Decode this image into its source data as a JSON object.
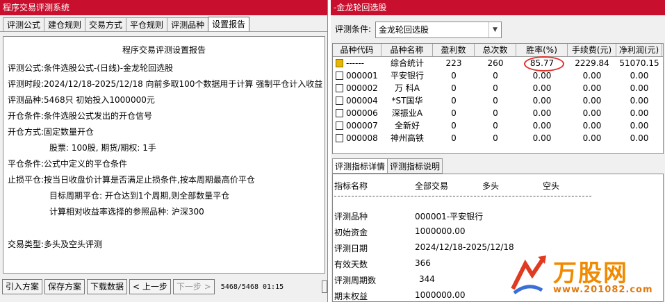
{
  "left": {
    "title": "程序交易评测系统",
    "tabs": [
      "评测公式",
      "建仓规则",
      "交易方式",
      "平仓规则",
      "评测品种",
      "设置报告"
    ],
    "report_title": "程序交易评测设置报告",
    "lines": [
      {
        "label": "评测公式:",
        "value": "条件选股公式-(日线)-金龙轮回选股"
      },
      {
        "label": "评测时段:",
        "value": "2024/12/18-2025/12/18 向前多取100个数据用于计算 强制平仓计入收益"
      },
      {
        "label": "评测品种:",
        "value": "5468只 初始投入1000000元"
      },
      {
        "label": "开仓条件:",
        "value": "条件选股公式发出的开仓信号"
      },
      {
        "label": "开仓方式:",
        "value": "固定数量开仓"
      },
      {
        "label": "",
        "value": "股票: 100股, 期货/期权: 1手"
      },
      {
        "label": "平仓条件:",
        "value": "公式中定义的平仓条件"
      },
      {
        "label": "止损平仓:",
        "value": "按当日收盘价计算是否满足止损条件,按本周期最高价平仓"
      },
      {
        "label": "",
        "value": "目标周期平仓: 开仓达到1个周期,则全部数量平仓"
      },
      {
        "label": "",
        "value": "计算相对收益率选择的参照品种: 沪深300"
      },
      {
        "label": "交易类型:",
        "value": "多头及空头评测"
      }
    ],
    "buttons": [
      "引入方案",
      "保存方案",
      "下载数据",
      "< 上一步",
      "下一步 >"
    ],
    "status": "5468/5468 01:15"
  },
  "right": {
    "title": "-金龙轮回选股",
    "condition_label": "评测条件:",
    "condition_value": "金龙轮回选股",
    "columns": [
      "品种代码",
      "品种名称",
      "盈利数",
      "总次数",
      "胜率(%)",
      "手续费(元)",
      "净利润(元)"
    ],
    "rows": [
      [
        "------",
        "综合统计",
        "223",
        "260",
        "85.77",
        "2229.84",
        "51070.15"
      ],
      [
        "000001",
        "平安银行",
        "0",
        "0",
        "0.00",
        "0.00",
        "0.00"
      ],
      [
        "000002",
        "万 科A",
        "0",
        "0",
        "0.00",
        "0.00",
        "0.00"
      ],
      [
        "000004",
        "*ST国华",
        "0",
        "0",
        "0.00",
        "0.00",
        "0.00"
      ],
      [
        "000006",
        "深振业A",
        "0",
        "0",
        "0.00",
        "0.00",
        "0.00"
      ],
      [
        "000007",
        "全新好",
        "0",
        "0",
        "0.00",
        "0.00",
        "0.00"
      ],
      [
        "000008",
        "神州高铁",
        "0",
        "0",
        "0.00",
        "0.00",
        "0.00"
      ]
    ],
    "bottom_tabs": [
      "评测指标详情",
      "评测指标说明"
    ],
    "detail_headers": [
      "指标名称",
      "全部交易",
      "多头",
      "空头"
    ],
    "detail": [
      {
        "label": "评测品种",
        "value": "000001-平安银行"
      },
      {
        "label": "初始资金",
        "value": "1000000.00"
      },
      {
        "label": "评测日期",
        "value": "2024/12/18-2025/12/18"
      },
      {
        "label": "有效天数",
        "value": "366"
      },
      {
        "label": "评测周期数",
        "value": "344"
      },
      {
        "label": "期末权益",
        "value": "1000000.00"
      }
    ]
  },
  "logo": {
    "text": "万股网",
    "url": "www.201082.com"
  }
}
